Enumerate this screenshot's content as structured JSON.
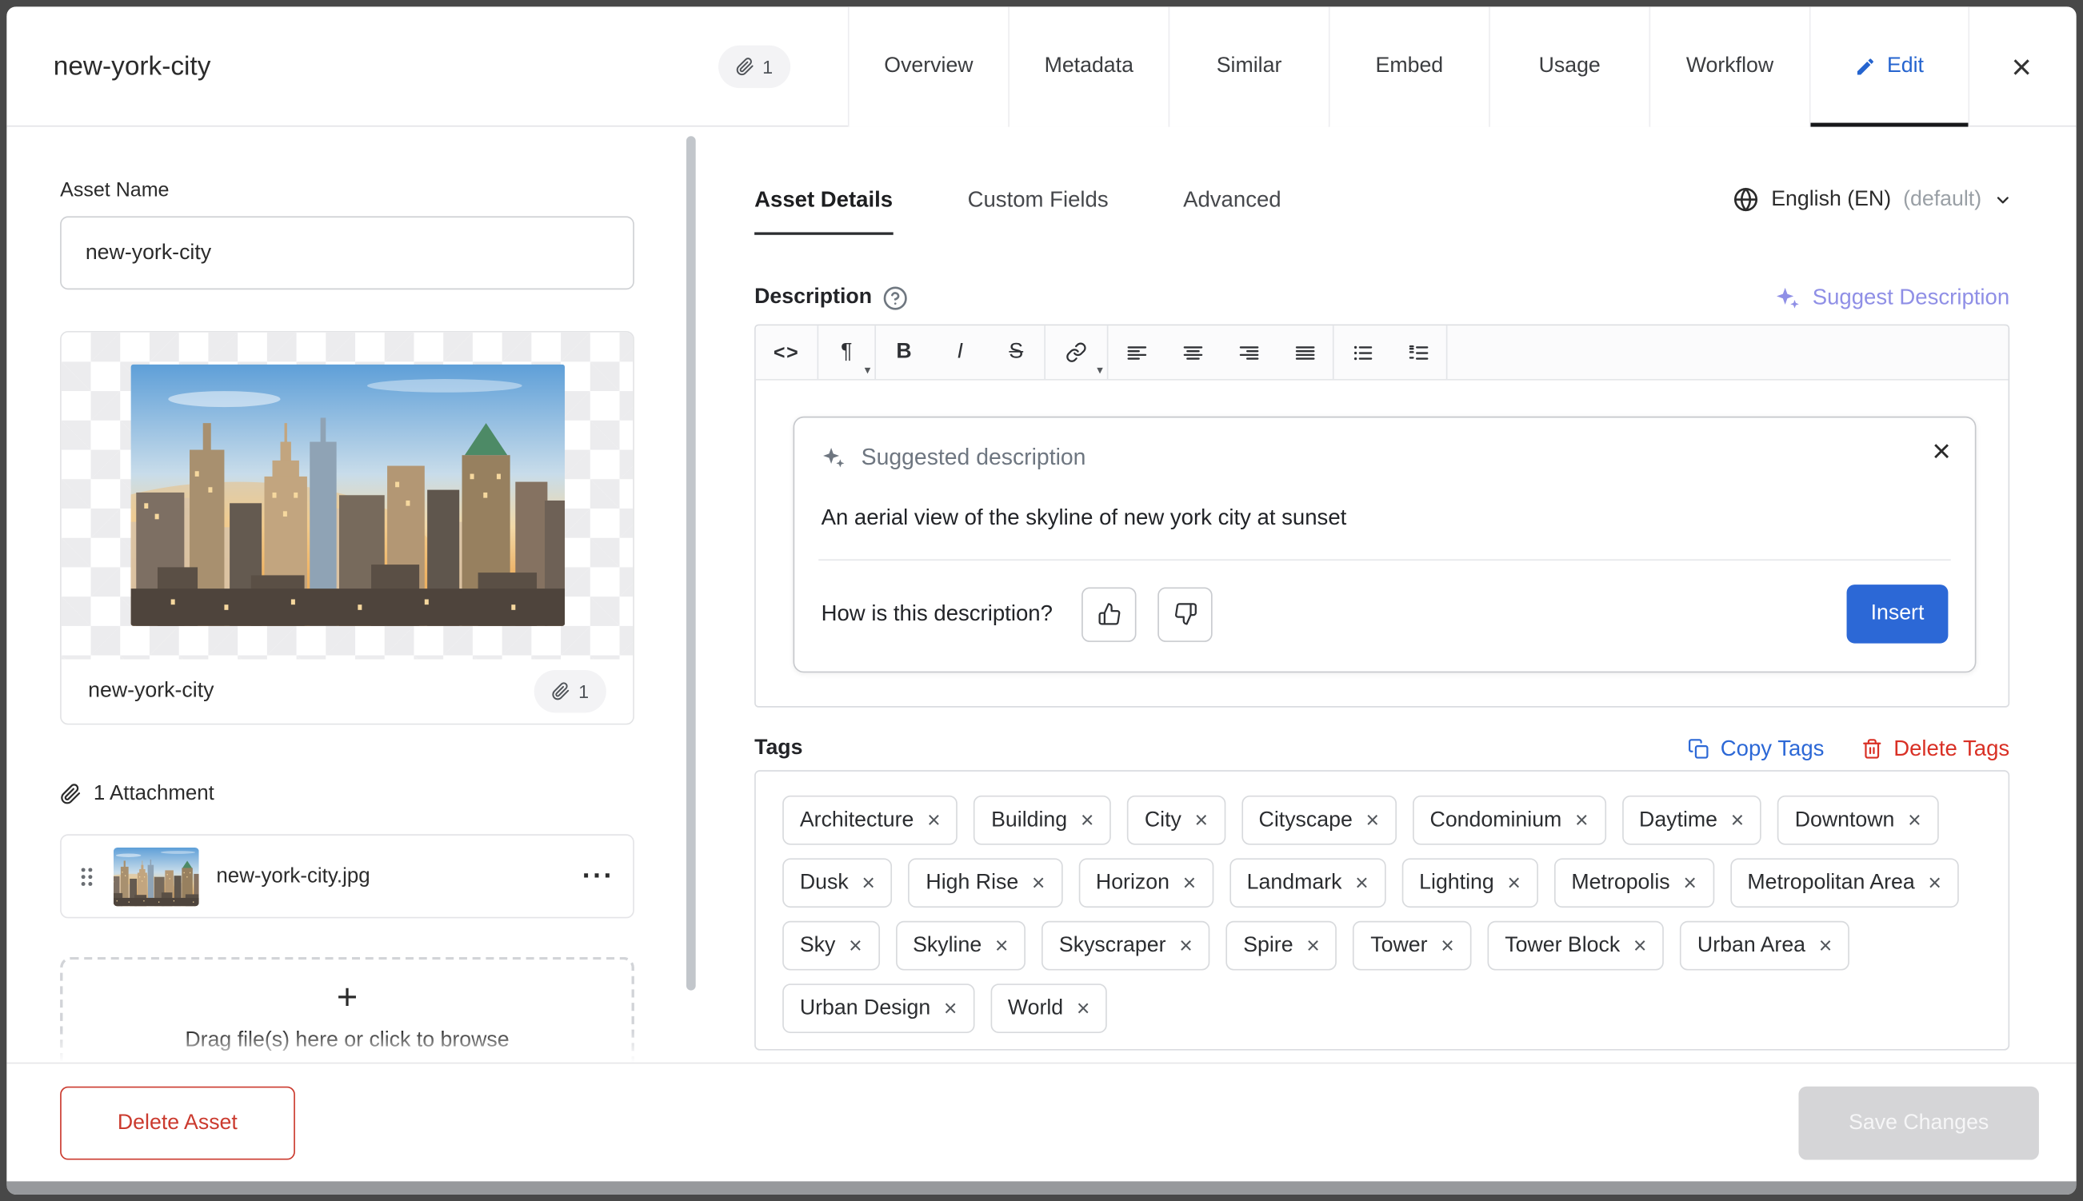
{
  "header": {
    "title": "new-york-city",
    "badge": "1",
    "tabs": [
      "Overview",
      "Metadata",
      "Similar",
      "Embed",
      "Usage",
      "Workflow",
      "Edit"
    ]
  },
  "left": {
    "asset_name_label": "Asset Name",
    "asset_name_value": "new-york-city",
    "preview_name": "new-york-city",
    "preview_badge": "1",
    "attachments_header": "1 Attachment",
    "attachment_filename": "new-york-city.jpg",
    "dropzone_text": "Drag file(s) here or click to browse",
    "delete_label": "Delete Asset"
  },
  "right": {
    "tabs": [
      "Asset Details",
      "Custom Fields",
      "Advanced"
    ],
    "language_label": "English (EN)",
    "language_suffix": "(default)",
    "description_label": "Description",
    "suggest_label": "Suggest Description",
    "suggestion_title": "Suggested description",
    "suggestion_text": "An aerial view of the skyline of new york city at sunset",
    "suggestion_question": "How is this description?",
    "insert_label": "Insert",
    "tags_label": "Tags",
    "copy_tags_label": "Copy Tags",
    "delete_tags_label": "Delete Tags",
    "tags": [
      "Architecture",
      "Building",
      "City",
      "Cityscape",
      "Condominium",
      "Daytime",
      "Downtown",
      "Dusk",
      "High Rise",
      "Horizon",
      "Landmark",
      "Lighting",
      "Metropolis",
      "Metropolitan Area",
      "Sky",
      "Skyline",
      "Skyscraper",
      "Spire",
      "Tower",
      "Tower Block",
      "Urban Area",
      "Urban Design",
      "World"
    ]
  },
  "footer": {
    "save_label": "Save Changes"
  },
  "icons": {
    "close": "×",
    "remove": "×",
    "ellipsis": "···",
    "plus": "+",
    "caret": "▾",
    "code": "<>",
    "pilcrow": "¶",
    "bold": "B",
    "italic": "I",
    "strike": "S"
  },
  "colors": {
    "accent_blue": "#2c68d6",
    "active_tab_blue": "#2564cf",
    "danger_red": "#cb3a2e",
    "delete_tags_red": "#d93025",
    "suggest_purple": "#8f8fe6",
    "disabled_gray": "#d5d5d7"
  }
}
